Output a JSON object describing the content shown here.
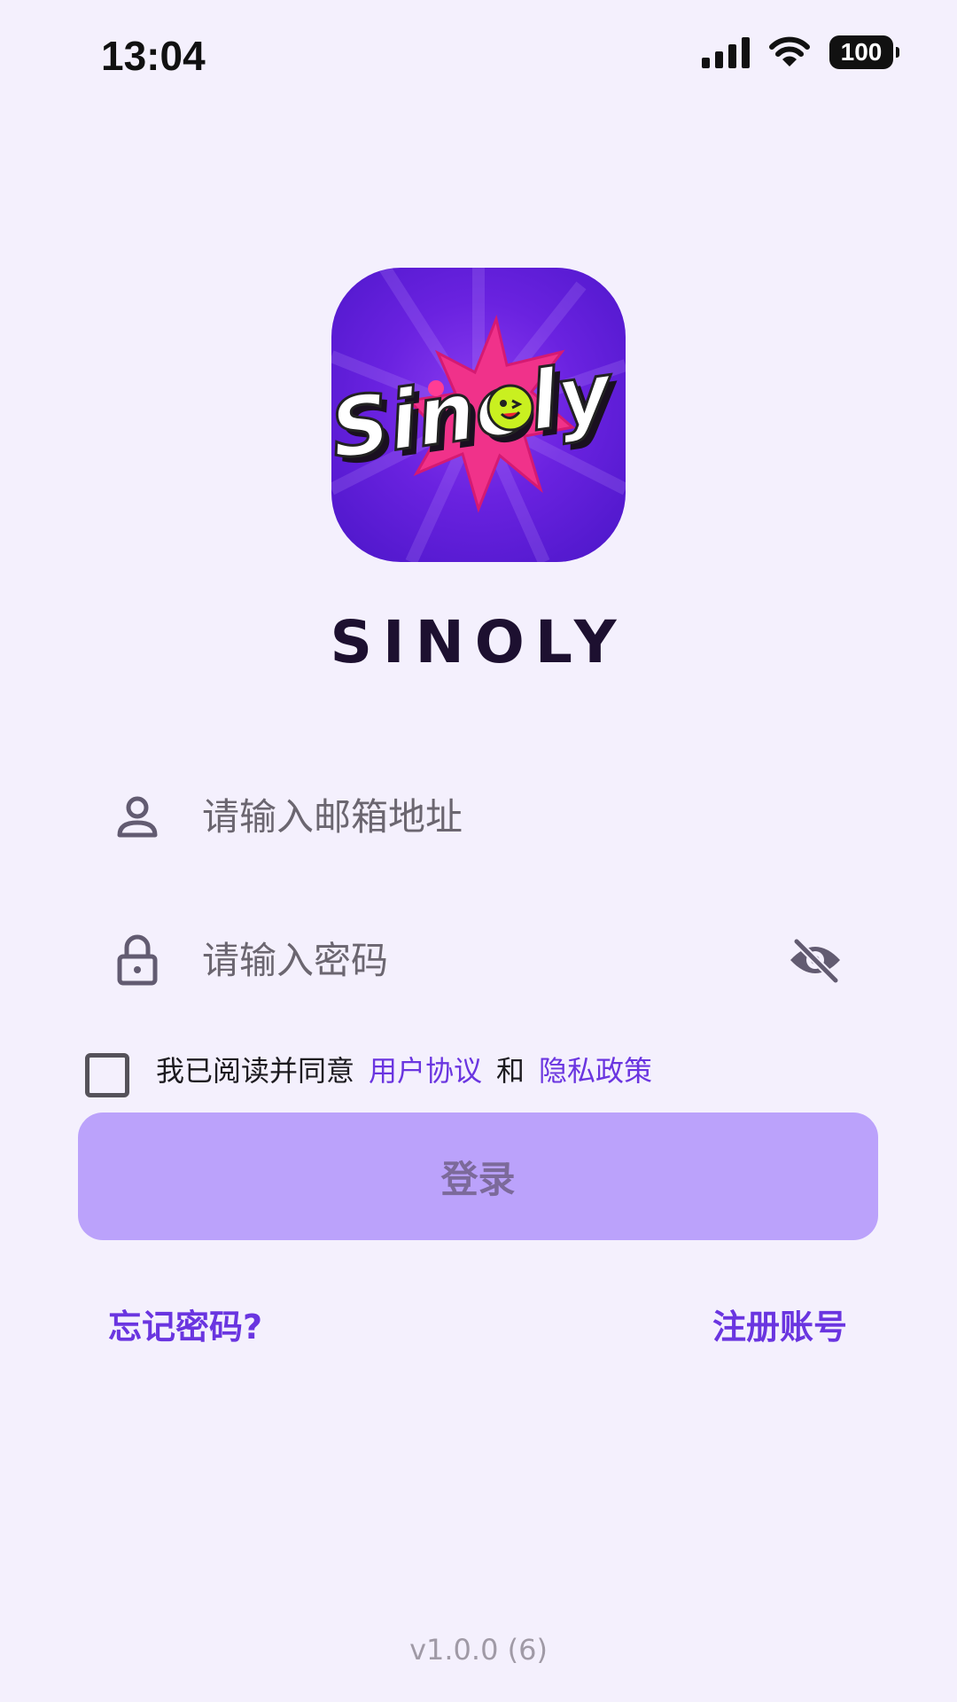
{
  "status_bar": {
    "time": "13:04",
    "battery": "100",
    "icons": [
      "signal-icon",
      "wifi-icon",
      "battery-icon"
    ]
  },
  "app": {
    "logo_text": "Sinoly",
    "name": "SINOLY"
  },
  "login_form": {
    "email_placeholder": "请输入邮箱地址",
    "password_placeholder": "请输入密码",
    "agreement": {
      "prefix": "我已阅读并同意",
      "user_agreement": "用户协议",
      "and": "和",
      "privacy_policy": "隐私政策"
    },
    "login_label": "登录",
    "forgot_password": "忘记密码?",
    "register": "注册账号"
  },
  "version": "v1.0.0 (6)",
  "colors": {
    "background": "#f4f0fd",
    "accent": "#6a35e0",
    "button": "#bba2fb"
  }
}
